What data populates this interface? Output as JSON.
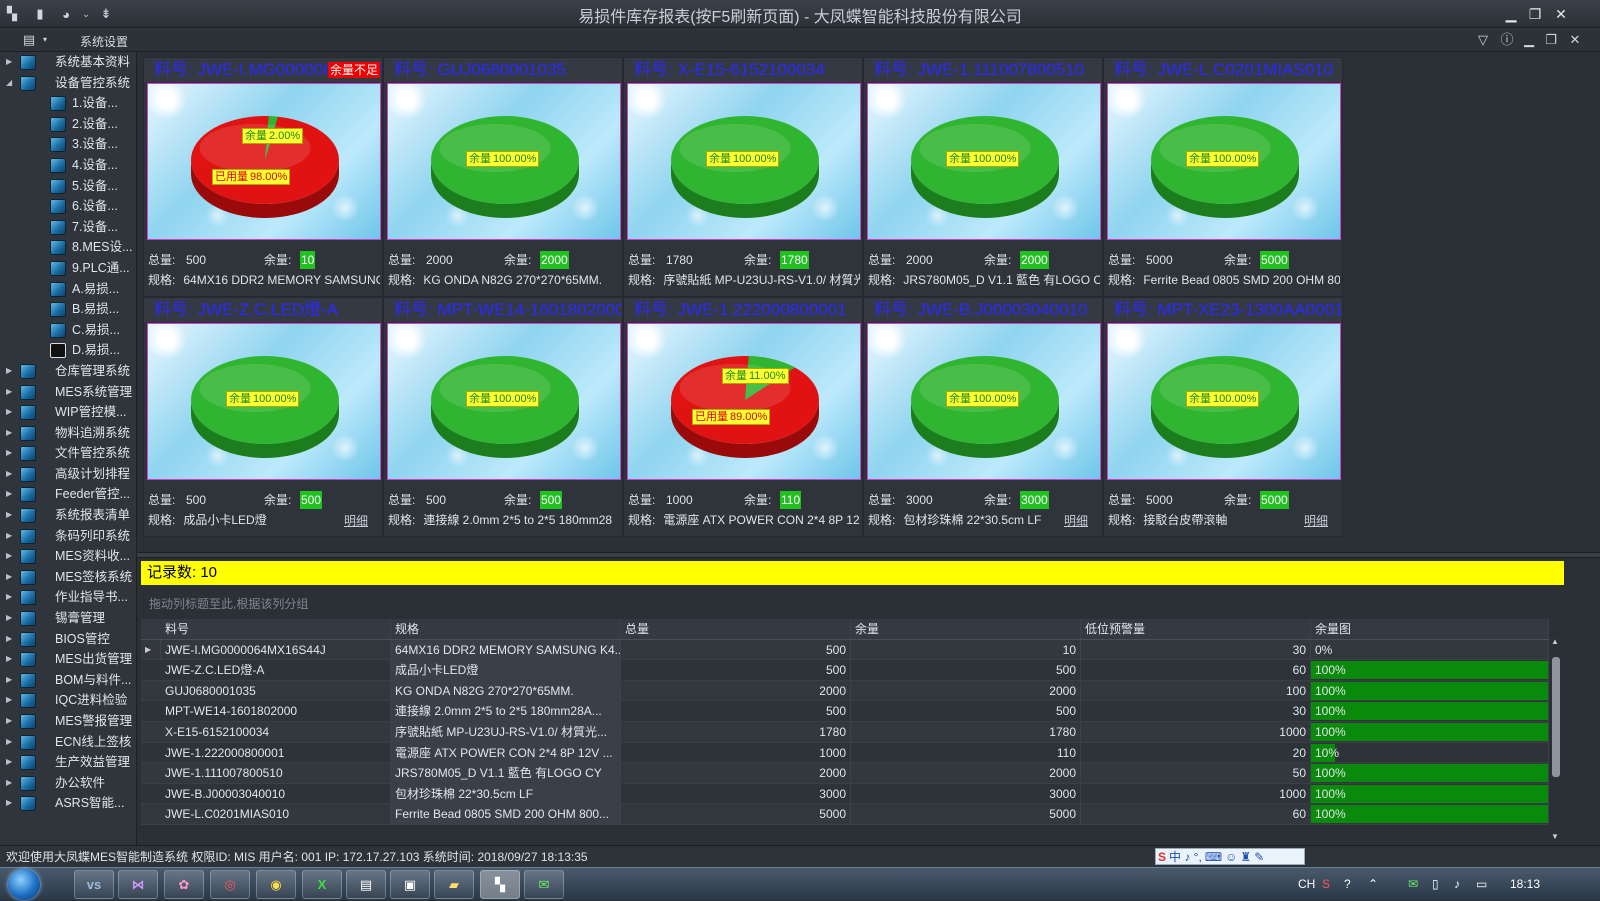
{
  "window": {
    "title": "易损件库存报表(按F5刷新页面) - 大凤蝶智能科技股份有限公司"
  },
  "menu": {
    "settings_label": "系统设置"
  },
  "sidebar": {
    "items": [
      {
        "label": "系统基本资料",
        "level": 0,
        "expanded": false
      },
      {
        "label": "设备管控系统",
        "level": 0,
        "expanded": true
      },
      {
        "label": "1.设备...",
        "level": 1
      },
      {
        "label": "2.设备...",
        "level": 1
      },
      {
        "label": "3.设备...",
        "level": 1
      },
      {
        "label": "4.设备...",
        "level": 1
      },
      {
        "label": "5.设备...",
        "level": 1
      },
      {
        "label": "6.设备...",
        "level": 1
      },
      {
        "label": "7.设备...",
        "level": 1
      },
      {
        "label": "8.MES设...",
        "level": 1
      },
      {
        "label": "9.PLC通...",
        "level": 1
      },
      {
        "label": "A.易损...",
        "level": 1
      },
      {
        "label": "B.易损...",
        "level": 1
      },
      {
        "label": "C.易损...",
        "level": 1
      },
      {
        "label": "D.易损...",
        "level": 1,
        "dark": true
      },
      {
        "label": "仓库管理系统",
        "level": 0
      },
      {
        "label": "MES系统管理",
        "level": 0
      },
      {
        "label": "WIP管控模...",
        "level": 0
      },
      {
        "label": "物料追溯系统",
        "level": 0
      },
      {
        "label": "文件管控系统",
        "level": 0
      },
      {
        "label": "高级计划排程",
        "level": 0
      },
      {
        "label": "Feeder管控...",
        "level": 0
      },
      {
        "label": "系统报表清单",
        "level": 0
      },
      {
        "label": "条码列印系统",
        "level": 0
      },
      {
        "label": "MES资料收...",
        "level": 0
      },
      {
        "label": "MES签核系统",
        "level": 0
      },
      {
        "label": "作业指导书...",
        "level": 0
      },
      {
        "label": "锡膏管理",
        "level": 0
      },
      {
        "label": "BIOS管控",
        "level": 0
      },
      {
        "label": "MES出货管理",
        "level": 0
      },
      {
        "label": "BOM与料件...",
        "level": 0
      },
      {
        "label": "IQC进料检验",
        "level": 0
      },
      {
        "label": "MES警报管理",
        "level": 0
      },
      {
        "label": "ECN线上签核",
        "level": 0
      },
      {
        "label": "生产效益管理",
        "level": 0
      },
      {
        "label": "办公软件",
        "level": 0
      },
      {
        "label": "ASRS智能...",
        "level": 0
      }
    ]
  },
  "labels": {
    "part_prefix": "料号: ",
    "total": "总量:",
    "remain": "余量:",
    "spec": "规格:",
    "remain_pct": "余量",
    "used_pct": "已用量",
    "shortage": "余量不足",
    "detail": "明细"
  },
  "colors": {
    "remain_slice": "#2fb52f",
    "used_slice": "#e01212",
    "part_title": "#2929ff",
    "count_bar": "#ffff00",
    "remain_highlight": "#22c122"
  },
  "cards": [
    {
      "part": "JWE-I.MG0000064MX16S44J",
      "total": "500",
      "remain": "10",
      "spec": "64MX16 DDR2 MEMORY SAMSUNG K4",
      "remain_ratio": 0.02,
      "remain_label": "2.00%",
      "used_label": "98.00%",
      "shortage": true,
      "show_detail": false
    },
    {
      "part": "GUJ0680001035",
      "total": "2000",
      "remain": "2000",
      "spec": "KG ONDA N82G 270*270*65MM.",
      "remain_ratio": 1,
      "remain_label": "100.00%",
      "show_detail": false
    },
    {
      "part": "X-E15-6152100034",
      "total": "1780",
      "remain": "1780",
      "spec": "序號貼紙 MP-U23UJ-RS-V1.0/ 材質光",
      "remain_ratio": 1,
      "remain_label": "100.00%",
      "show_detail": false
    },
    {
      "part": "JWE-1.111007800510",
      "total": "2000",
      "remain": "2000",
      "spec": "JRS780M05_D V1.1 藍色 有LOGO CY",
      "remain_ratio": 1,
      "remain_label": "100.00%",
      "show_detail": false
    },
    {
      "part": "JWE-L.C0201MIAS010",
      "total": "5000",
      "remain": "5000",
      "spec": "Ferrite Bead 0805 SMD 200 OHM 80",
      "remain_ratio": 1,
      "remain_label": "100.00%",
      "show_detail": false
    },
    {
      "part": "JWE-Z.C.LED燈-A",
      "total": "500",
      "remain": "500",
      "spec": "成品小卡LED燈",
      "remain_ratio": 1,
      "remain_label": "100.00%",
      "show_detail": true
    },
    {
      "part": "MPT-WE14-1601802000",
      "total": "500",
      "remain": "500",
      "spec": "連接線 2.0mm 2*5 to 2*5 180mm28",
      "remain_ratio": 1,
      "remain_label": "100.00%",
      "show_detail": false
    },
    {
      "part": "JWE-1.222000800001",
      "total": "1000",
      "remain": "110",
      "spec": "電源座 ATX POWER CON 2*4 8P 12",
      "remain_ratio": 0.11,
      "remain_label": "11.00%",
      "used_label": "89.00%",
      "show_detail": false
    },
    {
      "part": "JWE-B.J00003040010",
      "total": "3000",
      "remain": "3000",
      "spec": "包材珍珠棉 22*30.5cm LF",
      "remain_ratio": 1,
      "remain_label": "100.00%",
      "show_detail": true
    },
    {
      "part": "MPT-XE23-1300AA0001",
      "total": "5000",
      "remain": "5000",
      "spec": "接駁台皮帶滾軸",
      "remain_ratio": 1,
      "remain_label": "100.00%",
      "show_detail": true
    }
  ],
  "records": {
    "label": "记录数: 10"
  },
  "group_hint": "拖动列标题至此,根据该列分组",
  "table": {
    "columns": [
      "料号",
      "规格",
      "总量",
      "余量",
      "低位预警量",
      "余量图"
    ],
    "rows": [
      {
        "part": "JWE-I.MG0000064MX16S44J",
        "spec": "64MX16 DDR2 MEMORY SAMSUNG K4...",
        "total": "500",
        "remain": "10",
        "warn": "30",
        "pct_label": "0%",
        "fill": 0
      },
      {
        "part": "JWE-Z.C.LED燈-A",
        "spec": "成品小卡LED燈",
        "total": "500",
        "remain": "500",
        "warn": "60",
        "pct_label": "100%",
        "fill": 1
      },
      {
        "part": "GUJ0680001035",
        "spec": "KG ONDA N82G 270*270*65MM.",
        "total": "2000",
        "remain": "2000",
        "warn": "100",
        "pct_label": "100%",
        "fill": 1
      },
      {
        "part": "MPT-WE14-1601802000",
        "spec": "連接線 2.0mm 2*5 to 2*5 180mm28A...",
        "total": "500",
        "remain": "500",
        "warn": "30",
        "pct_label": "100%",
        "fill": 1
      },
      {
        "part": "X-E15-6152100034",
        "spec": "序號貼紙 MP-U23UJ-RS-V1.0/ 材質光...",
        "total": "1780",
        "remain": "1780",
        "warn": "1000",
        "pct_label": "100%",
        "fill": 1
      },
      {
        "part": "JWE-1.222000800001",
        "spec": "電源座 ATX POWER CON 2*4 8P 12V ...",
        "total": "1000",
        "remain": "110",
        "warn": "20",
        "pct_label": "10%",
        "fill": 0.1
      },
      {
        "part": "JWE-1.111007800510",
        "spec": "JRS780M05_D V1.1 藍色 有LOGO CY",
        "total": "2000",
        "remain": "2000",
        "warn": "50",
        "pct_label": "100%",
        "fill": 1
      },
      {
        "part": "JWE-B.J00003040010",
        "spec": "包材珍珠棉 22*30.5cm LF",
        "total": "3000",
        "remain": "3000",
        "warn": "1000",
        "pct_label": "100%",
        "fill": 1
      },
      {
        "part": "JWE-L.C0201MIAS010",
        "spec": "Ferrite Bead 0805 SMD 200 OHM 800...",
        "total": "5000",
        "remain": "5000",
        "warn": "60",
        "pct_label": "100%",
        "fill": 1
      }
    ]
  },
  "status": {
    "text": "欢迎使用大凤蝶MES智能制造系统   权限ID: MIS   用户名: 001   IP: 172.17.27.103   系统时间: 2018/09/27 18:13:35"
  },
  "ime": {
    "text": "中 ♪ °,"
  },
  "taskbar": {
    "clock": "18:13",
    "lang": "CH"
  }
}
